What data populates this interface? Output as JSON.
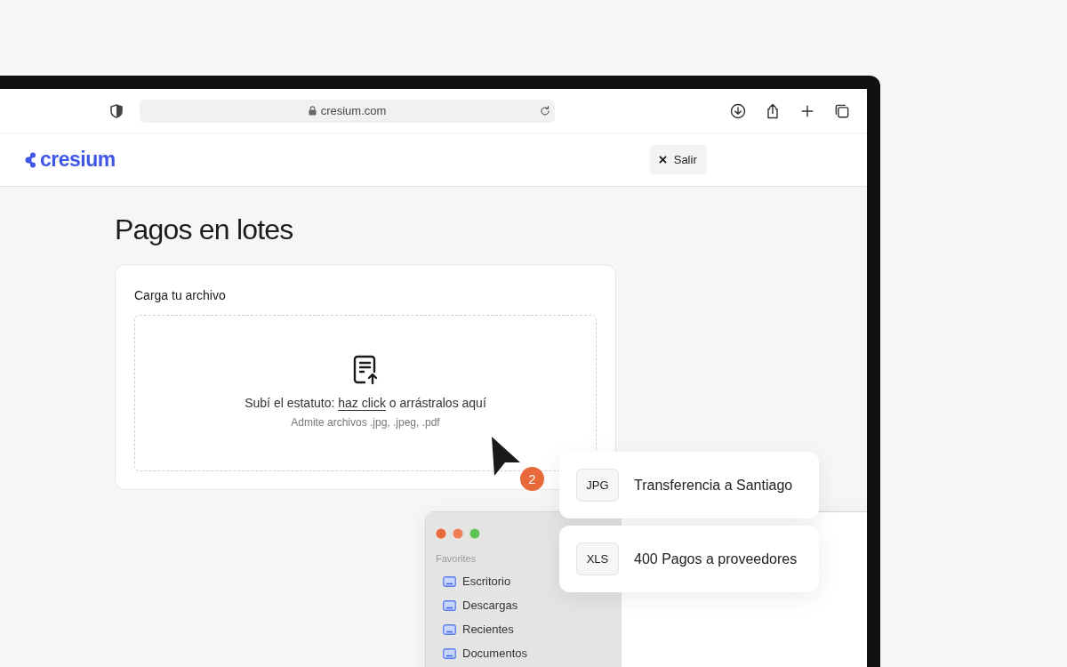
{
  "browser": {
    "url": "cresium.com"
  },
  "header": {
    "logo": "cresium",
    "exit_button": "Salir"
  },
  "page": {
    "title": "Pagos en lotes",
    "upload_card": {
      "label": "Carga tu archivo",
      "instruction_prefix": "Subí el estatuto: ",
      "link": "haz click",
      "instruction_suffix": " o arrástralos aquí",
      "hint": "Admite archivos .jpg, .jpeg, .pdf"
    }
  },
  "cursor": {
    "badge": "2"
  },
  "files": [
    {
      "type": "JPG",
      "name": "Transferencia a Santiago"
    },
    {
      "type": "XLS",
      "name": "400 Pagos a proveedores"
    }
  ],
  "finder": {
    "section": "Favorites",
    "items": [
      "Escritorio",
      "Descargas",
      "Recientes",
      "Documentos"
    ]
  }
}
